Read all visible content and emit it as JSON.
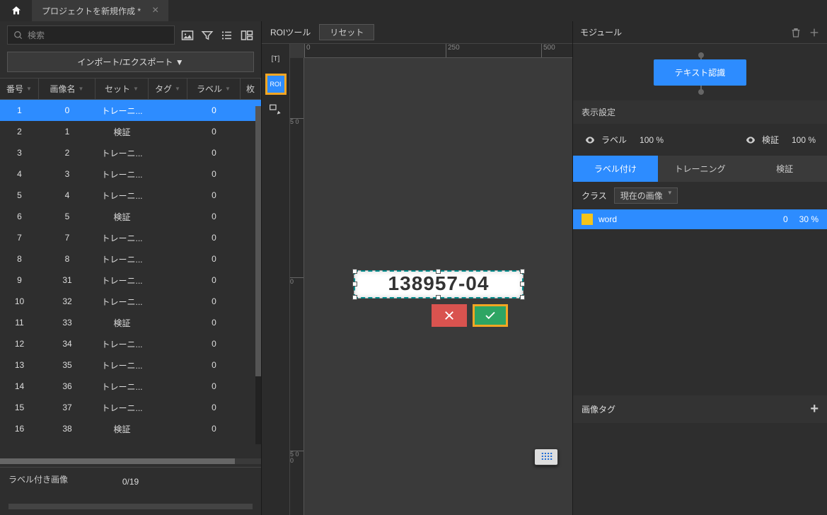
{
  "titlebar": {
    "tab_title": "プロジェクトを新規作成 *"
  },
  "left": {
    "search_placeholder": "検索",
    "import_export": "インポート/エクスポート ▼",
    "columns": {
      "num": "番号",
      "name": "画像名",
      "set": "セット",
      "tag": "タグ",
      "label": "ラベル",
      "last": "枚"
    },
    "rows": [
      {
        "num": "1",
        "name": "0",
        "set": "トレーニ...",
        "tag": "",
        "label": "0",
        "selected": true
      },
      {
        "num": "2",
        "name": "1",
        "set": "検証",
        "tag": "",
        "label": "0"
      },
      {
        "num": "3",
        "name": "2",
        "set": "トレーニ...",
        "tag": "",
        "label": "0"
      },
      {
        "num": "4",
        "name": "3",
        "set": "トレーニ...",
        "tag": "",
        "label": "0"
      },
      {
        "num": "5",
        "name": "4",
        "set": "トレーニ...",
        "tag": "",
        "label": "0"
      },
      {
        "num": "6",
        "name": "5",
        "set": "検証",
        "tag": "",
        "label": "0"
      },
      {
        "num": "7",
        "name": "7",
        "set": "トレーニ...",
        "tag": "",
        "label": "0"
      },
      {
        "num": "8",
        "name": "8",
        "set": "トレーニ...",
        "tag": "",
        "label": "0"
      },
      {
        "num": "9",
        "name": "31",
        "set": "トレーニ...",
        "tag": "",
        "label": "0"
      },
      {
        "num": "10",
        "name": "32",
        "set": "トレーニ...",
        "tag": "",
        "label": "0"
      },
      {
        "num": "11",
        "name": "33",
        "set": "検証",
        "tag": "",
        "label": "0"
      },
      {
        "num": "12",
        "name": "34",
        "set": "トレーニ...",
        "tag": "",
        "label": "0"
      },
      {
        "num": "13",
        "name": "35",
        "set": "トレーニ...",
        "tag": "",
        "label": "0"
      },
      {
        "num": "14",
        "name": "36",
        "set": "トレーニ...",
        "tag": "",
        "label": "0"
      },
      {
        "num": "15",
        "name": "37",
        "set": "トレーニ...",
        "tag": "",
        "label": "0"
      },
      {
        "num": "16",
        "name": "38",
        "set": "検証",
        "tag": "",
        "label": "0"
      }
    ],
    "labeled_images": "ラベル付き画像",
    "progress": "0/19"
  },
  "center": {
    "roi_tool": "ROIツール",
    "reset": "リセット",
    "tool_text": "[T]",
    "tool_roi": "ROI",
    "ruler_h": [
      "0",
      "250",
      "500"
    ],
    "ruler_v_top": "5\n0",
    "ruler_v_mid": "0",
    "ruler_v_bot": "5\n0\n0",
    "roi_content": "138957-04"
  },
  "right": {
    "module_title": "モジュール",
    "text_recognition": "テキスト認識",
    "display_settings": "表示設定",
    "vis_label": "ラベル",
    "vis_label_pct": "100 %",
    "vis_val": "検証",
    "vis_val_pct": "100 %",
    "tabs": {
      "labeling": "ラベル付け",
      "training": "トレーニング",
      "validation": "検証"
    },
    "class_label": "クラス",
    "class_select": "現在の画像",
    "class_name": "word",
    "class_count": "0",
    "class_pct": "30 %",
    "image_tag": "画像タグ"
  }
}
